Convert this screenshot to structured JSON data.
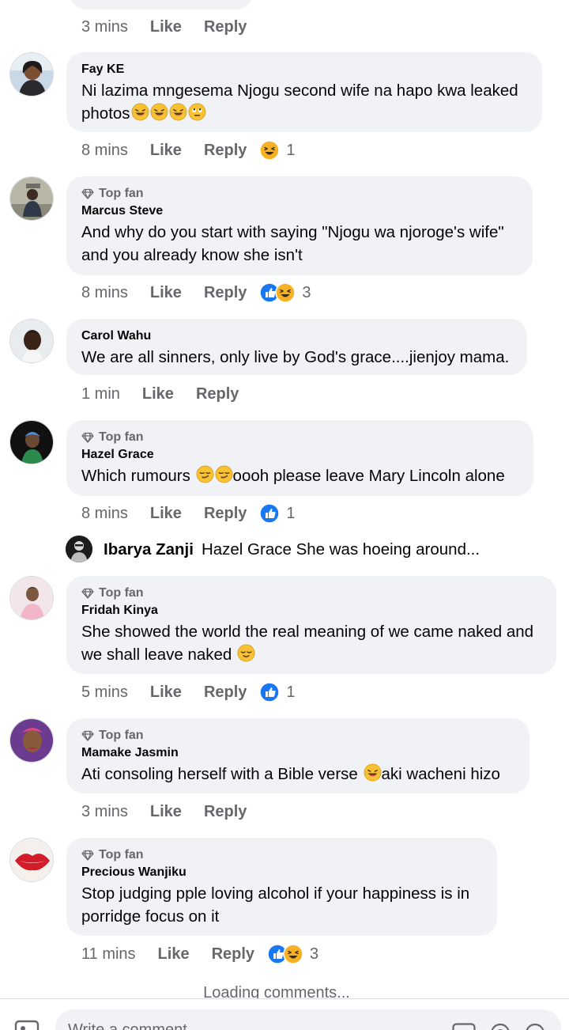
{
  "first_meta": {
    "time": "3 mins",
    "like": "Like",
    "reply": "Reply"
  },
  "comments": [
    {
      "author": "Fay KE",
      "top_fan": false,
      "text": "Ni lazima mngesema Njogu second wife na hapo kwa leaked",
      "text2": "photos",
      "emoji_line2": [
        "laughing-tears",
        "laughing-tears",
        "laughing-tears",
        "eye-roll"
      ],
      "time": "8 mins",
      "like": "Like",
      "reply": "Reply",
      "reactions": [
        "haha"
      ],
      "count": "1"
    },
    {
      "author": "Marcus Steve",
      "top_fan": true,
      "badge": "Top fan",
      "text": "And why do you start with saying \"Njogu wa njoroge's wife\"",
      "text2": "and you already know she isn't",
      "time": "8 mins",
      "like": "Like",
      "reply": "Reply",
      "reactions": [
        "like",
        "haha"
      ],
      "count": "3"
    },
    {
      "author": "Carol Wahu",
      "top_fan": false,
      "text": "We are all sinners, only live by God's grace....jienjoy mama.",
      "time": "1 min",
      "like": "Like",
      "reply": "Reply"
    },
    {
      "author": "Hazel Grace",
      "top_fan": true,
      "badge": "Top fan",
      "text_a": "Which rumours",
      "text_b": "oooh please leave Mary Lincoln alone",
      "emoji_mid": [
        "smirk",
        "smirk"
      ],
      "time": "8 mins",
      "like": "Like",
      "reply": "Reply",
      "reactions": [
        "like"
      ],
      "count": "1"
    },
    {
      "author": "Fridah Kinya",
      "top_fan": true,
      "badge": "Top fan",
      "text": "She showed the world the real meaning of we came naked and",
      "text2": "we shall leave naked",
      "emoji_line2": [
        "relieved"
      ],
      "time": "5 mins",
      "like": "Like",
      "reply": "Reply",
      "reactions": [
        "like"
      ],
      "count": "1"
    },
    {
      "author": "Mamake Jasmin",
      "top_fan": true,
      "badge": "Top fan",
      "text_a": "Ati consoling herself with a Bible verse",
      "text_b": "aki wacheni hizo",
      "emoji_mid": [
        "laughing-tears"
      ],
      "time": "3 mins",
      "like": "Like",
      "reply": "Reply"
    },
    {
      "author": "Precious Wanjiku",
      "top_fan": true,
      "badge": "Top fan",
      "text": "Stop judging pple loving alcohol if your happiness is in",
      "text2": "porridge focus on it",
      "time": "11 mins",
      "like": "Like",
      "reply": "Reply",
      "reactions": [
        "like",
        "haha"
      ],
      "count": "3"
    }
  ],
  "reply_preview": {
    "author": "Ibarya Zanji",
    "text": "Hazel Grace She was hoeing around..."
  },
  "loading_text": "Loading comments...",
  "composer": {
    "placeholder": "Write a comment...",
    "icons": [
      "camera-icon",
      "gif-icon",
      "sticker-icon",
      "emoji-icon"
    ]
  },
  "colors": {
    "bubble": "#f0f2f5",
    "meta": "#65676b",
    "like_blue": "#1877f2",
    "haha_yellow": "#f7b125"
  }
}
